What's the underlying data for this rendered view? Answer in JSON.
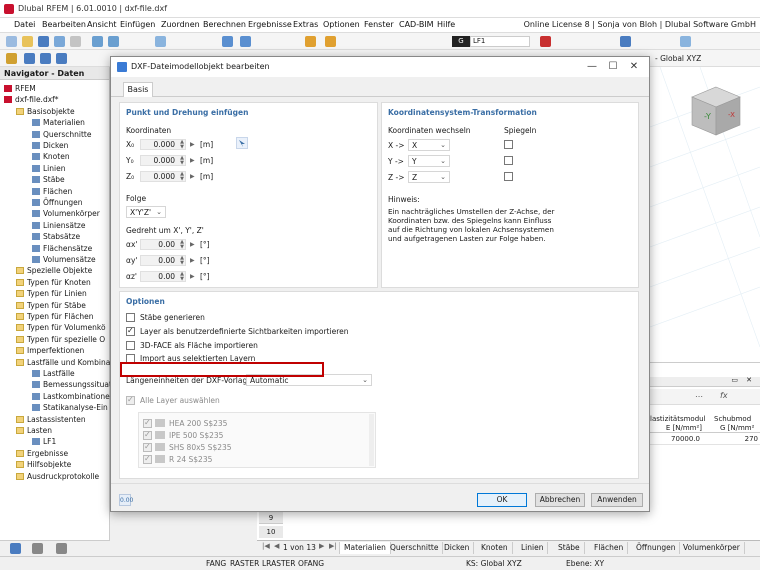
{
  "app": {
    "title": "Dlubal RFEM | 6.01.0010 | dxf-file.dxf"
  },
  "menu": {
    "items": [
      "Datei",
      "Bearbeiten",
      "Ansicht",
      "Einfügen",
      "Zuordnen",
      "Berechnen",
      "Ergebnisse",
      "Extras",
      "Optionen",
      "Fenster",
      "CAD-BIM",
      "Hilfe"
    ],
    "license": "Online License 8 | Sonja von Bloh | Dlubal Software GmbH"
  },
  "toolbar": {
    "lc_box": "G",
    "lc_name": "LF1",
    "cs": "- Global XYZ"
  },
  "navigator": {
    "title": "Navigator - Daten",
    "items": [
      {
        "label": "RFEM",
        "level": 0
      },
      {
        "label": "dxf-file.dxf*",
        "level": 0
      },
      {
        "label": "Basisobjekte",
        "level": 1
      },
      {
        "label": "Materialien",
        "level": 2
      },
      {
        "label": "Querschnitte",
        "level": 2
      },
      {
        "label": "Dicken",
        "level": 2
      },
      {
        "label": "Knoten",
        "level": 2
      },
      {
        "label": "Linien",
        "level": 2
      },
      {
        "label": "Stäbe",
        "level": 2
      },
      {
        "label": "Flächen",
        "level": 2
      },
      {
        "label": "Öffnungen",
        "level": 2
      },
      {
        "label": "Volumenkörper",
        "level": 2
      },
      {
        "label": "Liniensätze",
        "level": 2
      },
      {
        "label": "Stabsätze",
        "level": 2
      },
      {
        "label": "Flächensätze",
        "level": 2
      },
      {
        "label": "Volumensätze",
        "level": 2
      },
      {
        "label": "Spezielle Objekte",
        "level": 1
      },
      {
        "label": "Typen für Knoten",
        "level": 1
      },
      {
        "label": "Typen für Linien",
        "level": 1
      },
      {
        "label": "Typen für Stäbe",
        "level": 1
      },
      {
        "label": "Typen für Flächen",
        "level": 1
      },
      {
        "label": "Typen für Volumenkö",
        "level": 1
      },
      {
        "label": "Typen für spezielle O",
        "level": 1
      },
      {
        "label": "Imperfektionen",
        "level": 1
      },
      {
        "label": "Lastfälle und Kombina",
        "level": 1
      },
      {
        "label": "Lastfälle",
        "level": 2
      },
      {
        "label": "Bemessungssituat",
        "level": 2
      },
      {
        "label": "Lastkombinatione",
        "level": 2
      },
      {
        "label": "Statikanalyse-Ein",
        "level": 2
      },
      {
        "label": "Lastassistenten",
        "level": 1
      },
      {
        "label": "Lasten",
        "level": 1
      },
      {
        "label": "LF1",
        "level": 2
      },
      {
        "label": "Ergebnisse",
        "level": 1
      },
      {
        "label": "Hilfsobjekte",
        "level": 1
      },
      {
        "label": "Ausdruckprotokolle",
        "level": 1
      }
    ]
  },
  "dialog": {
    "title": "DXF-Dateimodellobjekt bearbeiten",
    "tab": "Basis",
    "insert_point": {
      "section_title": "Punkt und Drehung einfügen",
      "coords_label": "Koordinaten",
      "coords": [
        {
          "label": "X₀",
          "value": "0.000",
          "unit": "[m]"
        },
        {
          "label": "Y₀",
          "value": "0.000",
          "unit": "[m]"
        },
        {
          "label": "Z₀",
          "value": "0.000",
          "unit": "[m]"
        }
      ],
      "order_label": "Folge",
      "order_value": "X'Y'Z'",
      "rotated_label": "Gedreht um X', Y', Z'",
      "rotations": [
        {
          "label": "αx'",
          "value": "0.00",
          "unit": "[°]"
        },
        {
          "label": "αy'",
          "value": "0.00",
          "unit": "[°]"
        },
        {
          "label": "αz'",
          "value": "0.00",
          "unit": "[°]"
        }
      ]
    },
    "transform": {
      "section_title": "Koordinatensystem-Transformation",
      "switch_label": "Koordinaten wechseln",
      "mirror_label": "Spiegeln",
      "rows": [
        {
          "label": "X ->",
          "value": "X"
        },
        {
          "label": "Y ->",
          "value": "Y"
        },
        {
          "label": "Z ->",
          "value": "Z"
        }
      ],
      "hint_title": "Hinweis:",
      "hint_text": "Ein nachträgliches Umstellen der Z-Achse, der Koordinaten bzw. des Spiegelns kann Einfluss auf die Richtung von lokalen Achsensystemen und aufgetragenen Lasten zur Folge haben."
    },
    "options": {
      "section_title": "Optionen",
      "checkboxes": [
        {
          "label": "Stäbe generieren",
          "checked": false
        },
        {
          "label": "Layer als benutzerdefinierte Sichtbarkeiten importieren",
          "checked": true
        },
        {
          "label": "3D-FACE als Fläche importieren",
          "checked": false
        },
        {
          "label": "Import aus selektierten Layern",
          "checked": false
        }
      ],
      "length_units_label": "Längeneinheiten der DXF-Vorlage",
      "length_units_value": "Automatic",
      "all_layers_label": "Alle Layer auswählen",
      "layers": [
        "HEA 200 S$235",
        "IPE 500 S$235",
        "SHS 80x5 S$235",
        "R 24 S$235"
      ]
    },
    "buttons": {
      "ok": "OK",
      "cancel": "Abbrechen",
      "apply": "Anwenden"
    }
  },
  "table": {
    "col1_header": "lastizitätsmodul",
    "col1_sub": "E [N/mm²]",
    "col2_header": "Schubmod",
    "col2_sub": "G [N/mm²",
    "col1_value": "70000.0",
    "col2_value": "270",
    "row_labels": [
      "9",
      "10"
    ]
  },
  "bottom": {
    "pager": "1 von 13",
    "tabs": [
      "Materialien",
      "Querschnitte",
      "Dicken",
      "Knoten",
      "Linien",
      "Stäbe",
      "Flächen",
      "Öffnungen",
      "Volumenkörper"
    ]
  },
  "status": {
    "items": [
      "FANG",
      "RASTER",
      "LRASTER",
      "OFANG"
    ],
    "cs": "KS: Global XYZ",
    "plane": "Ebene: XY"
  }
}
